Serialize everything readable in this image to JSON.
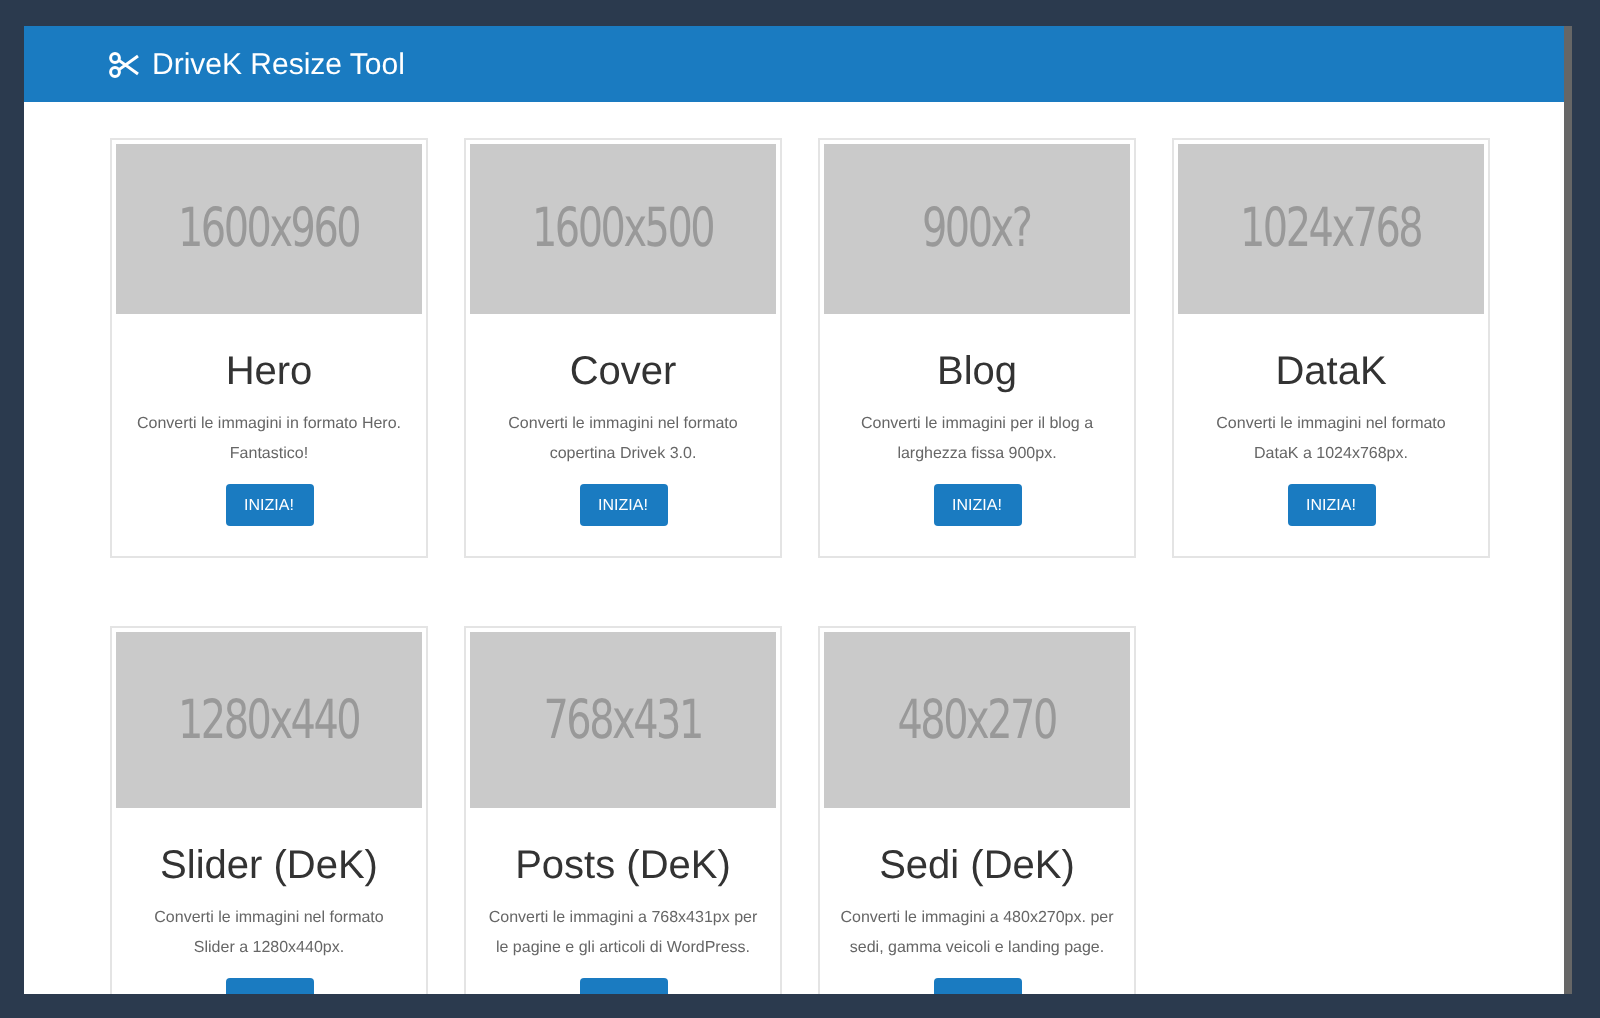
{
  "header": {
    "title": "DriveK Resize Tool"
  },
  "cards": [
    {
      "image_label": "1600x960",
      "title": "Hero",
      "description": "Converti le immagini in formato Hero. Fantastico!",
      "button": {
        "label": "INIZIA!",
        "cut_off": false
      }
    },
    {
      "image_label": "1600x500",
      "title": "Cover",
      "description": "Converti le immagini nel formato copertina Drivek 3.0.",
      "button": {
        "label": "INIZIA!",
        "cut_off": false
      }
    },
    {
      "image_label": "900x?",
      "title": "Blog",
      "description": "Converti le immagini per il blog a larghezza fissa 900px.",
      "button": {
        "label": "INIZIA!",
        "cut_off": false
      }
    },
    {
      "image_label": "1024x768",
      "title": "DataK",
      "description": "Converti le immagini nel formato DataK a 1024x768px.",
      "button": {
        "label": "INIZIA!",
        "cut_off": false
      }
    },
    {
      "image_label": "1280x440",
      "title": "Slider (DeK)",
      "description": "Converti le immagini nel formato Slider a 1280x440px.",
      "button": {
        "cut_off": true
      }
    },
    {
      "image_label": "768x431",
      "title": "Posts (DeK)",
      "description": "Converti le immagini a 768x431px per le pagine e gli articoli di WordPress.",
      "button": {
        "cut_off": true
      }
    },
    {
      "image_label": "480x270",
      "title": "Sedi (DeK)",
      "description": "Converti le immagini a 480x270px. per sedi, gamma veicoli e landing page.",
      "button": {
        "cut_off": true
      }
    }
  ]
}
